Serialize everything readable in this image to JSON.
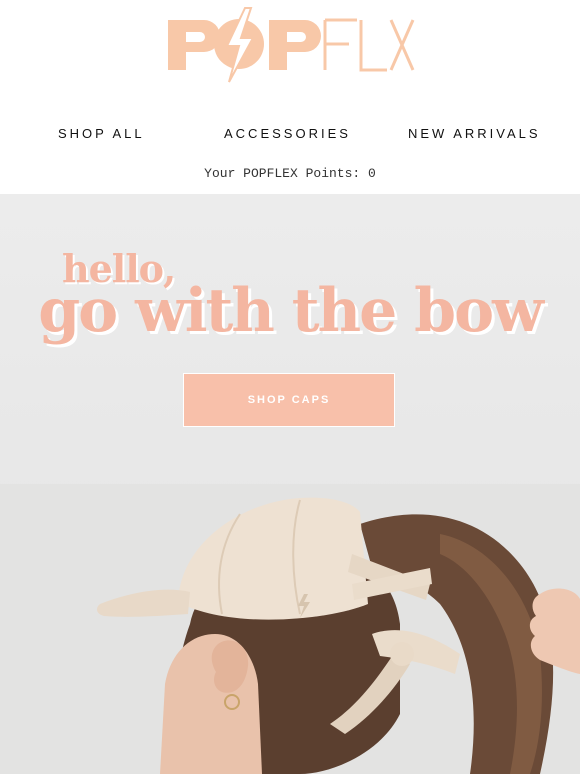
{
  "brand": {
    "name": "POPFLEX",
    "logo_color": "#f8c8a8"
  },
  "nav": {
    "items": [
      {
        "label": "SHOP ALL"
      },
      {
        "label": "ACCESSORIES"
      },
      {
        "label": "NEW ARRIVALS"
      }
    ]
  },
  "points": {
    "text": "Your POPFLEX Points: 0"
  },
  "hero": {
    "greeting": "hello,",
    "headline": "go with the bow",
    "cta_label": "SHOP CAPS",
    "accent_color": "#f4b6a1",
    "photo_alt": "woman wearing cream ponytail cap with bow tie back"
  }
}
